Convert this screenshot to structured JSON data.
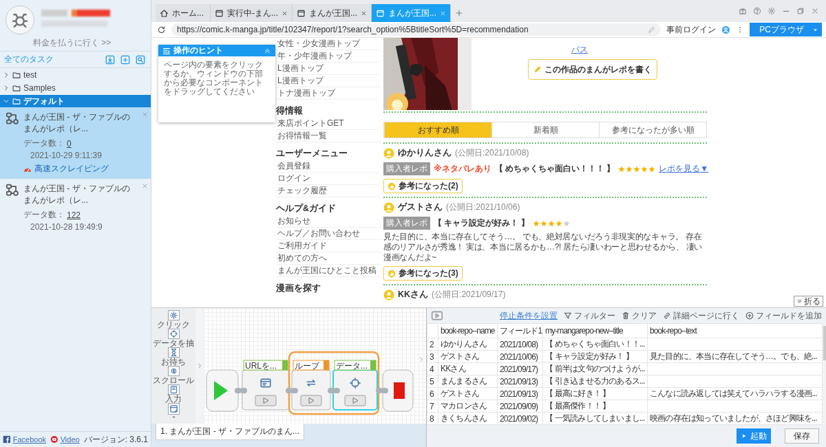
{
  "sidebar": {
    "pay_link": "料金を払うに行く >>",
    "section_title": "全てのタスク",
    "tree": [
      {
        "label": "test",
        "expanded": false,
        "selected": false
      },
      {
        "label": "Samples",
        "expanded": false,
        "selected": false
      },
      {
        "label": "デフォルト",
        "expanded": true,
        "selected": true,
        "children": [
          {
            "name": "まんが王国 - ザ・ファブルのまんがレポ（レ...",
            "count_label": "データ数：",
            "count": "0",
            "date": "2021-10-29 9:11:39",
            "tag": "高速スクレイピング",
            "selected": true
          },
          {
            "name": "まんが王国 - ザ・ファブルのまんがレポ（レ...",
            "count_label": "データ数：",
            "count": "122",
            "date": "2021-10-28 19:49:9",
            "selected": false
          }
        ]
      }
    ],
    "footer_links": [
      {
        "label": "Facebook",
        "kind": "facebook"
      },
      {
        "label": "Video",
        "kind": "video"
      }
    ],
    "version": "バージョン: 3.6.1"
  },
  "browser": {
    "tabs": [
      {
        "label": "ホーム...",
        "kind": "home",
        "closable": false,
        "selected": false
      },
      {
        "label": "実行中-まん...",
        "kind": "page",
        "closable": true,
        "selected": false
      },
      {
        "label": "まんが王国...",
        "kind": "page",
        "closable": true,
        "selected": false
      },
      {
        "label": "まんが王国...",
        "kind": "page",
        "closable": true,
        "selected": true
      }
    ],
    "url": "https://comic.k-manga.jp/title/102347/report/1?search_option%5BtitleSort%5D=recommendation",
    "login_link": "事前ログイン",
    "mode_button": "PCブラウザ"
  },
  "hint": {
    "title": "操作のヒント",
    "text": "ページ内の要素をクリックするか、ウィンドウの下部から必要なコンポーネントをドラッグしてください"
  },
  "page": {
    "nav": [
      {
        "items": [
          "女性・少女漫画トップ",
          "年・少年漫画トップ",
          "L漫画トップ",
          "L漫画トップ",
          "トナ漫画トップ"
        ]
      },
      {
        "heading": "得情報",
        "items": [
          "来店ポイントGET",
          "お得情報一覧"
        ]
      },
      {
        "heading": "ユーザーメニュー",
        "items": [
          "会員登録",
          "ログイン",
          "チェック履歴"
        ]
      },
      {
        "heading": "ヘルプ&ガイド",
        "items": [
          "お知らせ",
          "ヘルプ／お問い合わせ",
          "ご利用ガイド",
          "初めての方へ",
          "まんが王国にひとこと投稿"
        ]
      },
      {
        "heading": "漫画を探す"
      }
    ],
    "genre_link": "パス",
    "write_button": "この作品のまんがレポを書く",
    "sort_tabs": [
      {
        "label": "おすすめ順",
        "selected": true
      },
      {
        "label": "新着順",
        "selected": false
      },
      {
        "label": "参考になったが多い順",
        "selected": false
      }
    ],
    "reviews": [
      {
        "name": "ゆかりんさん",
        "date": "(公開日:2021/10/08)",
        "badge": "購入者レポ",
        "spoiler": "※ネタバレあり",
        "title": "【 めちゃくちゃ面白い！！！ 】",
        "stars": 5,
        "more_link": "レポを見る▼",
        "helpful": "参考になった(2)"
      },
      {
        "name": "ゲストさん",
        "date": "(公開日:2021/10/06)",
        "badge": "購入者レポ",
        "title": "【 キャラ設定が好み！ 】",
        "stars": 4,
        "body": "見た目的に、本当に存在してそう…。 でも、絶対居ないだろう非現実的なキャラ。 存在感のリアルさが秀逸！ 実は、本当に居るかも…?! 居たら凄いわーと思わせるから、 凄い漫画なんだよ~",
        "helpful": "参考になった(3)"
      },
      {
        "name": "KKさん",
        "date": "(公開日:2021/09/17)"
      }
    ]
  },
  "collapse_button": "折る",
  "workflow": {
    "tools": [
      {
        "label": "クリック",
        "kind": "click"
      },
      {
        "label": "データを抽",
        "kind": "extract"
      },
      {
        "label": "お待ち",
        "kind": "wait"
      },
      {
        "label": "スクロール",
        "kind": "scroll"
      },
      {
        "label": "入力",
        "kind": "input"
      },
      {
        "kind": "more"
      }
    ],
    "steps": [
      {
        "label": "URLを...",
        "kind": "open",
        "selected": false
      },
      {
        "label": "ループ",
        "kind": "loop",
        "selected": false,
        "children": [
          {
            "label": "データ...",
            "kind": "extract",
            "selected": true
          }
        ]
      }
    ],
    "task_tab": "1. まんが王国 - ザ・ファブルのまん..."
  },
  "results": {
    "stop_link": "停止条件を設置",
    "actions": [
      {
        "label": "フィルター",
        "kind": "filter"
      },
      {
        "label": "クリア",
        "kind": "clear"
      },
      {
        "label": "詳細ページに行く",
        "kind": "link"
      },
      {
        "label": "フィールドを追加",
        "kind": "add"
      }
    ],
    "columns": [
      "book-repo--name",
      "フィールド1",
      "my-mangarepo-new--title",
      "book-repo--text"
    ],
    "rows": [
      {
        "index": "2",
        "cells": [
          "ゆかりんさん",
          "2021/10/08)",
          "【 めちゃくちゃ面白い！！..."
        ]
      },
      {
        "index": "3",
        "cells": [
          "ゲストさん",
          "2021/10/06)",
          "【 キャラ設定が好み！ 】",
          "見た目的に、本当に存在してそう…。でも、絶..."
        ]
      },
      {
        "index": "4",
        "cells": [
          "KKさん",
          "2021/09/17)",
          "【 前半は文句のつけようが..."
        ]
      },
      {
        "index": "5",
        "cells": [
          "まんまるさん",
          "2021/09/13)",
          "【 引き込ませる力のあるス..."
        ]
      },
      {
        "index": "6",
        "cells": [
          "ゲストさん",
          "2021/09/13)",
          "【 最高に好き！ 】",
          "こんなに読み返しては笑えてハラハラする漫画..."
        ]
      },
      {
        "index": "7",
        "cells": [
          "マカロンさん",
          "2021/09/09)",
          "【 最高傑作！！ 】"
        ]
      },
      {
        "index": "8",
        "cells": [
          "きくちんさん",
          "2021/09/02)",
          "【 一気読みしてしまいまし...",
          "映画の存在は知っていましたが、さほど興味を..."
        ]
      }
    ],
    "run_button": "起動",
    "save_button": "保存"
  }
}
